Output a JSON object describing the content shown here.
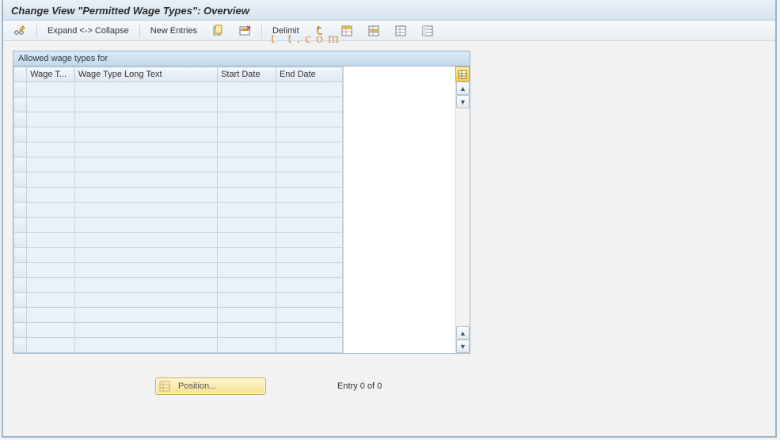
{
  "title": "Change View \"Permitted Wage Types\": Overview",
  "toolbar": {
    "expand_collapse": "Expand <-> Collapse",
    "new_entries": "New Entries",
    "delimit": "Delimit"
  },
  "panel": {
    "title": "Allowed wage types for",
    "columns": {
      "wage_type": "Wage T...",
      "long_text": "Wage Type Long Text",
      "start_date": "Start Date",
      "end_date": "End Date"
    },
    "rows": [
      {
        "wt": "",
        "long": "",
        "start": "",
        "end": ""
      },
      {
        "wt": "",
        "long": "",
        "start": "",
        "end": ""
      },
      {
        "wt": "",
        "long": "",
        "start": "",
        "end": ""
      },
      {
        "wt": "",
        "long": "",
        "start": "",
        "end": ""
      },
      {
        "wt": "",
        "long": "",
        "start": "",
        "end": ""
      },
      {
        "wt": "",
        "long": "",
        "start": "",
        "end": ""
      },
      {
        "wt": "",
        "long": "",
        "start": "",
        "end": ""
      },
      {
        "wt": "",
        "long": "",
        "start": "",
        "end": ""
      },
      {
        "wt": "",
        "long": "",
        "start": "",
        "end": ""
      },
      {
        "wt": "",
        "long": "",
        "start": "",
        "end": ""
      },
      {
        "wt": "",
        "long": "",
        "start": "",
        "end": ""
      },
      {
        "wt": "",
        "long": "",
        "start": "",
        "end": ""
      },
      {
        "wt": "",
        "long": "",
        "start": "",
        "end": ""
      },
      {
        "wt": "",
        "long": "",
        "start": "",
        "end": ""
      },
      {
        "wt": "",
        "long": "",
        "start": "",
        "end": ""
      },
      {
        "wt": "",
        "long": "",
        "start": "",
        "end": ""
      },
      {
        "wt": "",
        "long": "",
        "start": "",
        "end": ""
      },
      {
        "wt": "",
        "long": "",
        "start": "",
        "end": ""
      }
    ]
  },
  "footer": {
    "position_label": "Position...",
    "entry_text": "Entry 0 of 0"
  },
  "watermark": "t       t.com"
}
